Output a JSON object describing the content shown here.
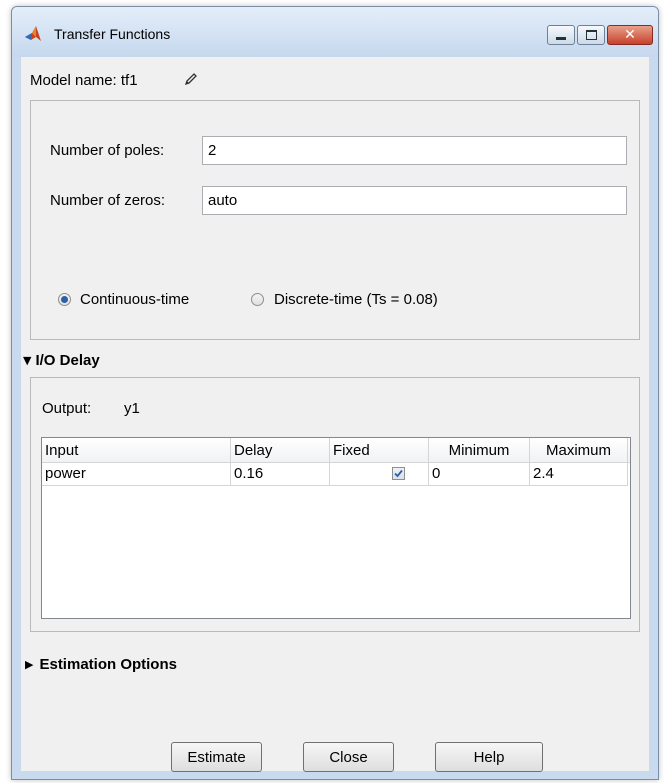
{
  "window": {
    "title": "Transfer Functions",
    "icons": {
      "app": "matlab-logo-icon",
      "minimize": "minimize-icon",
      "maximize": "maximize-icon",
      "close": "close-icon"
    },
    "close_glyph": "✕",
    "colors": {
      "frame": "#c9daee",
      "close_button": "#c7412c"
    }
  },
  "model": {
    "label": "Model name: tf1",
    "edit_icon": "pencil-icon"
  },
  "structure": {
    "poles_label": "Number of poles:",
    "poles_value": "2",
    "zeros_label": "Number of zeros:",
    "zeros_value": "auto",
    "time_options": [
      {
        "label": "Continuous-time",
        "selected": true
      },
      {
        "label": "Discrete-time (Ts = 0.08)",
        "selected": false
      }
    ]
  },
  "io_delay": {
    "header": "I/O Delay",
    "expanded": true,
    "output_label": "Output:",
    "output_value": "y1",
    "columns": [
      "Input",
      "Delay",
      "Fixed",
      "Minimum",
      "Maximum"
    ],
    "rows": [
      {
        "input": "power",
        "delay": "0.16",
        "fixed": true,
        "minimum": "0",
        "maximum": "2.4"
      }
    ]
  },
  "estimation_options": {
    "header": "Estimation Options",
    "expanded": false
  },
  "buttons": {
    "estimate": "Estimate",
    "close": "Close",
    "help": "Help"
  }
}
